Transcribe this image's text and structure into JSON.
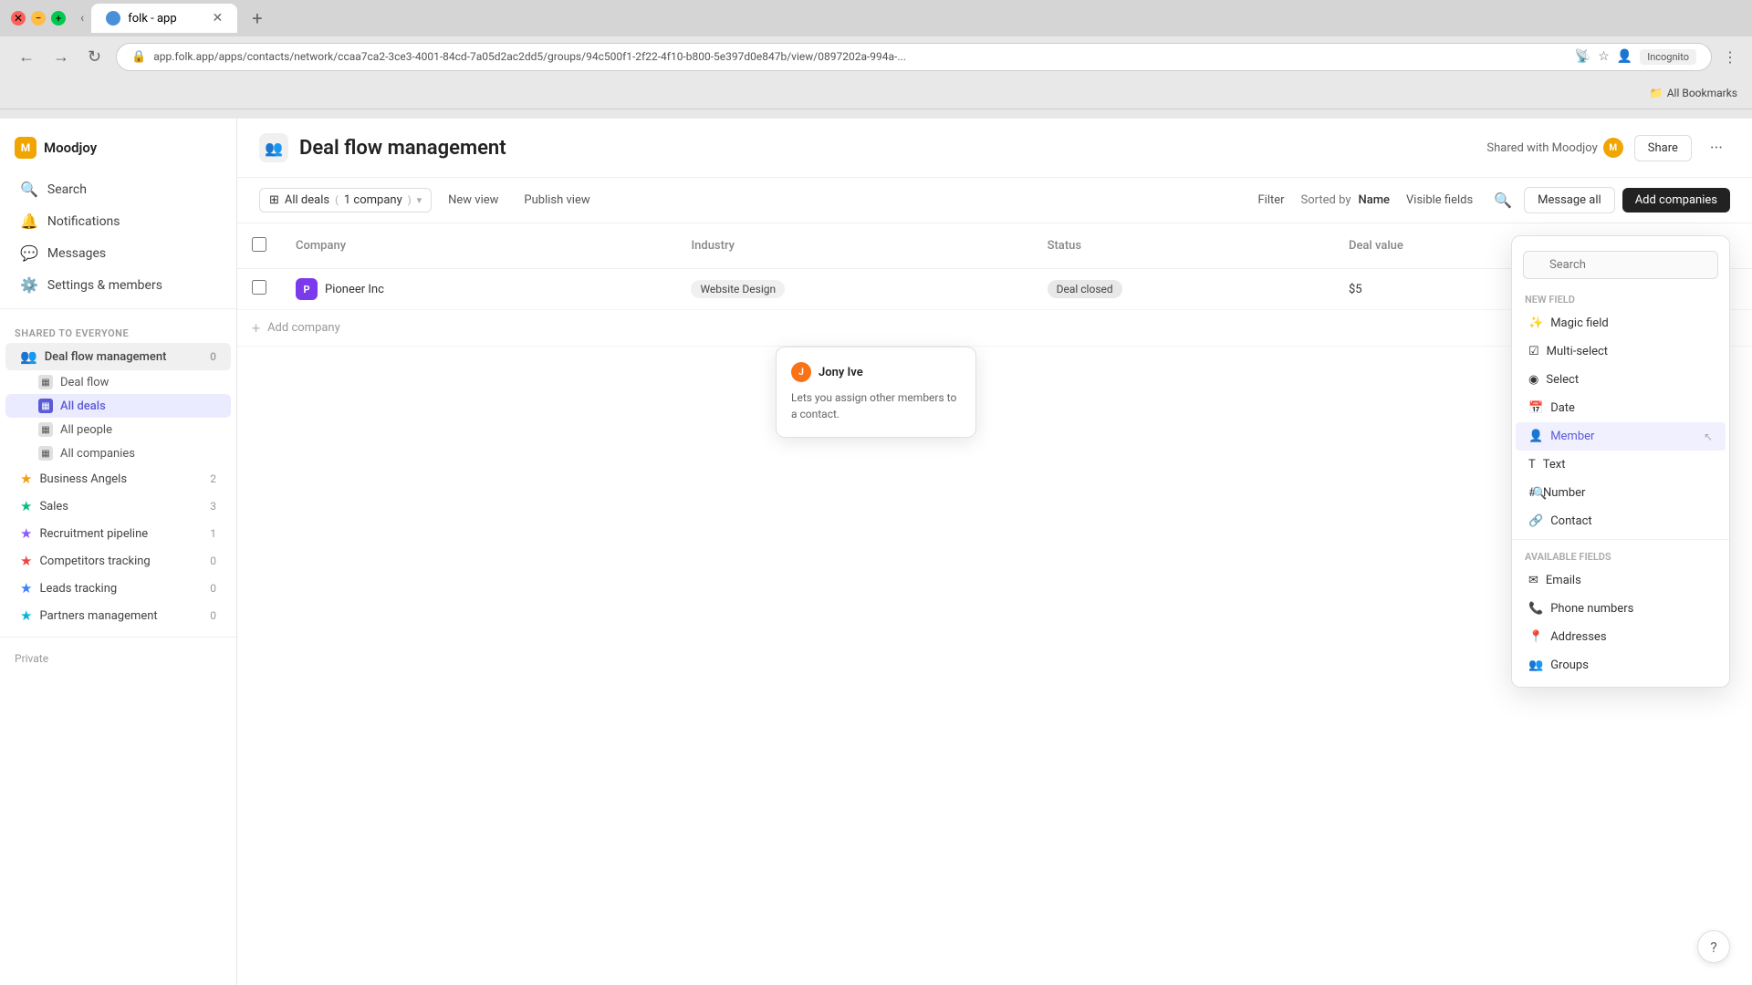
{
  "browser": {
    "tab_label": "folk - app",
    "url": "app.folk.app/apps/contacts/network/ccaa7ca2-3ce3-4001-84cd-7a05d2ac2dd5/groups/94c500f1-2f22-4f10-b800-5e397d0e847b/view/0897202a-994a-...",
    "incognito_label": "Incognito",
    "bookmarks_label": "All Bookmarks",
    "new_tab_label": "+"
  },
  "sidebar": {
    "brand_name": "Moodjoy",
    "brand_initial": "M",
    "nav_items": [
      {
        "id": "search",
        "label": "Search",
        "icon": "🔍"
      },
      {
        "id": "notifications",
        "label": "Notifications",
        "icon": "🔔"
      },
      {
        "id": "messages",
        "label": "Messages",
        "icon": "💬"
      },
      {
        "id": "settings",
        "label": "Settings & members",
        "icon": "⚙️"
      }
    ],
    "shared_section_label": "Shared to everyone",
    "groups": [
      {
        "id": "deal-flow-management",
        "label": "Deal flow management",
        "icon": "👥",
        "count": "0",
        "active": true,
        "sub_items": [
          {
            "id": "deal-flow",
            "label": "Deal flow",
            "icon": "📋"
          },
          {
            "id": "all-deals",
            "label": "All deals",
            "icon": "📋",
            "active": true
          },
          {
            "id": "all-people",
            "label": "All people",
            "icon": "👤"
          },
          {
            "id": "all-companies",
            "label": "All companies",
            "icon": "🏢"
          }
        ]
      },
      {
        "id": "business-angels",
        "label": "Business Angels",
        "icon": "⭐",
        "count": "2"
      },
      {
        "id": "sales",
        "label": "Sales",
        "icon": "⭐",
        "count": "3"
      },
      {
        "id": "recruitment-pipeline",
        "label": "Recruitment pipeline",
        "icon": "⭐",
        "count": "1"
      },
      {
        "id": "competitors-tracking",
        "label": "Competitors tracking",
        "icon": "⭐",
        "count": "0"
      },
      {
        "id": "leads-tracking",
        "label": "Leads tracking",
        "icon": "⭐",
        "count": "0"
      },
      {
        "id": "partners-management",
        "label": "Partners management",
        "icon": "⭐",
        "count": "0"
      }
    ],
    "private_label": "Private"
  },
  "page": {
    "title": "Deal flow management",
    "title_icon": "👥",
    "shared_with_label": "Shared with Moodjoy",
    "shared_avatar_initial": "M",
    "share_button_label": "Share",
    "more_button_label": "..."
  },
  "toolbar": {
    "view_label": "All deals",
    "view_count": "1 company",
    "new_view_label": "New view",
    "publish_view_label": "Publish view",
    "filter_label": "Filter",
    "sorted_by_label": "Sorted by",
    "sorted_by_value": "Name",
    "visible_fields_label": "Visible fields",
    "message_all_label": "Message all",
    "add_companies_label": "Add companies"
  },
  "table": {
    "headers": [
      "",
      "Company",
      "",
      "Industry",
      "Status",
      "Deal value",
      ""
    ],
    "rows": [
      {
        "avatar_initial": "P",
        "company_name": "Pioneer Inc",
        "industry": "Website Design",
        "status": "Deal closed",
        "deal_value": "$5"
      }
    ],
    "add_company_label": "Add company"
  },
  "tooltip": {
    "user_name": "Jony Ive",
    "user_initial": "J",
    "description": "Lets you assign other members to a contact."
  },
  "dropdown": {
    "search_placeholder": "Search",
    "new_field_section": "New field",
    "items": [
      {
        "id": "magic-field",
        "label": "Magic field"
      },
      {
        "id": "multi-select",
        "label": "Multi-select"
      },
      {
        "id": "select",
        "label": "Select"
      },
      {
        "id": "date",
        "label": "Date"
      },
      {
        "id": "member",
        "label": "Member",
        "highlighted": true
      },
      {
        "id": "text",
        "label": "Text"
      },
      {
        "id": "number",
        "label": "Number"
      },
      {
        "id": "contact",
        "label": "Contact"
      }
    ],
    "available_fields_label": "Available fields",
    "available_items": [
      {
        "id": "emails",
        "label": "Emails"
      },
      {
        "id": "phone-numbers",
        "label": "Phone numbers"
      },
      {
        "id": "addresses",
        "label": "Addresses"
      },
      {
        "id": "groups",
        "label": "Groups"
      }
    ]
  }
}
